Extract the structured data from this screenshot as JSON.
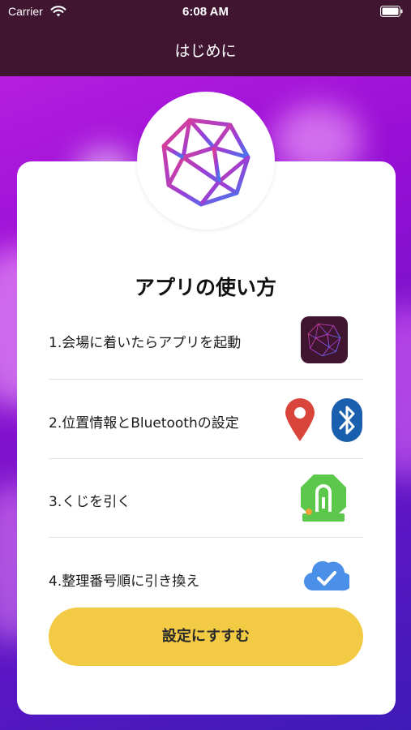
{
  "status_bar": {
    "carrier": "Carrier",
    "time": "6:08 AM"
  },
  "nav": {
    "title": "はじめに"
  },
  "main": {
    "heading": "アプリの使い方",
    "steps": [
      {
        "label": "1.会場に着いたらアプリを起動",
        "icons": [
          "app-logo-icon"
        ]
      },
      {
        "label": "2.位置情報とBluetoothの設定",
        "icons": [
          "location-pin-icon",
          "bluetooth-icon"
        ]
      },
      {
        "label": "3.くじを引く",
        "icons": [
          "lottery-machine-icon"
        ]
      },
      {
        "label": "4.整理番号順に引き換え",
        "icons": [
          "cloud-check-icon"
        ]
      }
    ],
    "cta_label": "設定にすすむ"
  },
  "colors": {
    "nav_background": "#3f1530",
    "cta_background": "#f3ca43",
    "location_pin": "#d9443b",
    "bluetooth": "#1a5fae",
    "lottery_green": "#5bc84b",
    "cloud_blue": "#4a8fe8"
  }
}
